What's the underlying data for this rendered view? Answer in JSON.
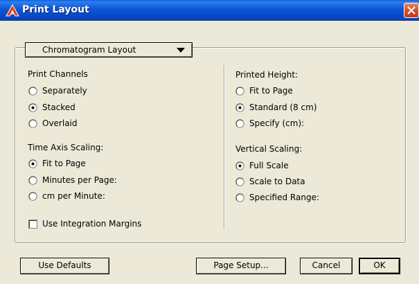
{
  "window": {
    "title": "Print Layout",
    "icon": "agilent-logo-icon",
    "close_icon": "close-icon"
  },
  "layout_dropdown": {
    "selected": "Chromatogram Layout",
    "arrow_icon": "triangle-down-icon"
  },
  "left_column": {
    "print_channels": {
      "label": "Print Channels",
      "options": [
        {
          "label": "Separately",
          "selected": false
        },
        {
          "label": "Stacked",
          "selected": true
        },
        {
          "label": "Overlaid",
          "selected": false
        }
      ]
    },
    "time_axis_scaling": {
      "label": "Time Axis Scaling:",
      "options": [
        {
          "label": "Fit to Page",
          "selected": true
        },
        {
          "label": "Minutes per Page:",
          "selected": false
        },
        {
          "label": "cm per Minute:",
          "selected": false
        }
      ]
    },
    "integration_margins": {
      "label": "Use Integration Margins",
      "checked": false
    }
  },
  "right_column": {
    "printed_height": {
      "label": "Printed Height:",
      "options": [
        {
          "label": "Fit to Page",
          "selected": false
        },
        {
          "label": "Standard (8 cm)",
          "selected": true
        },
        {
          "label": "Specify (cm):",
          "selected": false
        }
      ]
    },
    "vertical_scaling": {
      "label": "Vertical Scaling:",
      "options": [
        {
          "label": "Full Scale",
          "selected": true
        },
        {
          "label": "Scale to Data",
          "selected": false
        },
        {
          "label": "Specified Range:",
          "selected": false
        }
      ]
    }
  },
  "buttons": {
    "use_defaults": "Use Defaults",
    "page_setup": "Page Setup...",
    "cancel": "Cancel",
    "ok": "OK"
  }
}
